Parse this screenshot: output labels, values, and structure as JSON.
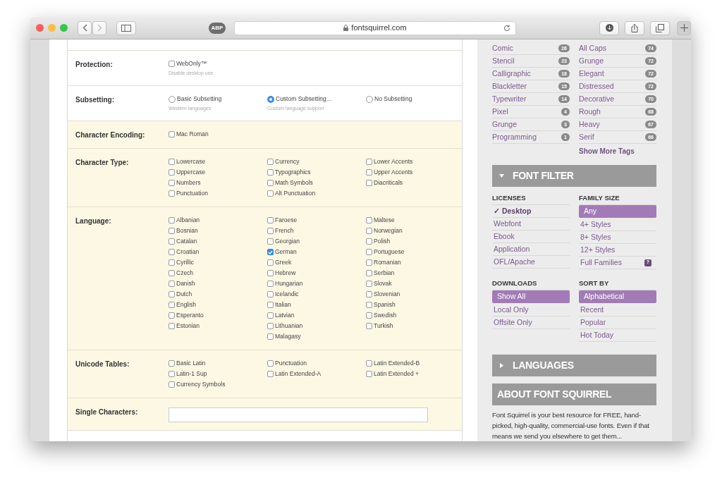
{
  "browser": {
    "address": "fontsquirrel.com",
    "adblock": "ABP"
  },
  "form": {
    "sections": [
      {
        "label": "Protection:",
        "highlighted": false,
        "kind": "checkbox",
        "columns": [
          [
            {
              "label": "WebOnly™",
              "hint": "Disable desktop use",
              "checked": false
            }
          ]
        ]
      },
      {
        "label": "Subsetting:",
        "highlighted": false,
        "kind": "radio",
        "columns": [
          [
            {
              "label": "Basic Subsetting",
              "hint": "Western languages",
              "selected": false
            }
          ],
          [
            {
              "label": "Custom Subsetting…",
              "hint": "Custom language support",
              "selected": true
            }
          ],
          [
            {
              "label": "No Subsetting",
              "selected": false
            }
          ]
        ]
      },
      {
        "label": "Character Encoding:",
        "highlighted": true,
        "kind": "checkbox",
        "columns": [
          [
            {
              "label": "Mac Roman",
              "checked": false
            }
          ]
        ]
      },
      {
        "label": "Character Type:",
        "highlighted": true,
        "kind": "checkbox",
        "columns": [
          [
            {
              "label": "Lowercase",
              "checked": false
            },
            {
              "label": "Uppercase",
              "checked": false
            },
            {
              "label": "Numbers",
              "checked": false
            },
            {
              "label": "Punctuation",
              "checked": false
            }
          ],
          [
            {
              "label": "Currency",
              "checked": false
            },
            {
              "label": "Typographics",
              "checked": false
            },
            {
              "label": "Math Symbols",
              "checked": false
            },
            {
              "label": "Alt Punctuation",
              "checked": false
            }
          ],
          [
            {
              "label": "Lower Accents",
              "checked": false
            },
            {
              "label": "Upper Accents",
              "checked": false
            },
            {
              "label": "Diacriticals",
              "checked": false
            }
          ]
        ]
      },
      {
        "label": "Language:",
        "highlighted": true,
        "kind": "checkbox",
        "columns": [
          [
            {
              "label": "Albanian",
              "checked": false
            },
            {
              "label": "Bosnian",
              "checked": false
            },
            {
              "label": "Catalan",
              "checked": false
            },
            {
              "label": "Croatian",
              "checked": false
            },
            {
              "label": "Cyrillic",
              "checked": false
            },
            {
              "label": "Czech",
              "checked": false
            },
            {
              "label": "Danish",
              "checked": false
            },
            {
              "label": "Dutch",
              "checked": false
            },
            {
              "label": "English",
              "checked": false
            },
            {
              "label": "Esperanto",
              "checked": false
            },
            {
              "label": "Estonian",
              "checked": false
            }
          ],
          [
            {
              "label": "Faroese",
              "checked": false
            },
            {
              "label": "French",
              "checked": false
            },
            {
              "label": "Georgian",
              "checked": false
            },
            {
              "label": "German",
              "checked": true
            },
            {
              "label": "Greek",
              "checked": false
            },
            {
              "label": "Hebrew",
              "checked": false
            },
            {
              "label": "Hungarian",
              "checked": false
            },
            {
              "label": "Icelandic",
              "checked": false
            },
            {
              "label": "Italian",
              "checked": false
            },
            {
              "label": "Latvian",
              "checked": false
            },
            {
              "label": "Lithuanian",
              "checked": false
            },
            {
              "label": "Malagasy",
              "checked": false
            }
          ],
          [
            {
              "label": "Maltese",
              "checked": false
            },
            {
              "label": "Norwegian",
              "checked": false
            },
            {
              "label": "Polish",
              "checked": false
            },
            {
              "label": "Portuguese",
              "checked": false
            },
            {
              "label": "Romanian",
              "checked": false
            },
            {
              "label": "Serbian",
              "checked": false
            },
            {
              "label": "Slovak",
              "checked": false
            },
            {
              "label": "Slovenian",
              "checked": false
            },
            {
              "label": "Spanish",
              "checked": false
            },
            {
              "label": "Swedish",
              "checked": false
            },
            {
              "label": "Turkish",
              "checked": false
            }
          ]
        ]
      },
      {
        "label": "Unicode Tables:",
        "highlighted": true,
        "kind": "checkbox",
        "columns": [
          [
            {
              "label": "Basic Latin",
              "checked": false
            },
            {
              "label": "Latin-1 Sup",
              "checked": false
            },
            {
              "label": "Currency Symbols",
              "checked": false
            }
          ],
          [
            {
              "label": "Punctuation",
              "checked": false
            },
            {
              "label": "Latin Extended-A",
              "checked": false
            }
          ],
          [
            {
              "label": "Latin Extended-B",
              "checked": false
            },
            {
              "label": "Latin Extended +",
              "checked": false
            }
          ]
        ]
      },
      {
        "label": "Single Characters:",
        "highlighted": true,
        "kind": "field"
      }
    ]
  },
  "sidebar": {
    "tags": {
      "columns": [
        [
          {
            "label": "Comic",
            "count": "26"
          },
          {
            "label": "Stencil",
            "count": "23"
          },
          {
            "label": "Calligraphic",
            "count": "18"
          },
          {
            "label": "Blackletter",
            "count": "15"
          },
          {
            "label": "Typewriter",
            "count": "14"
          },
          {
            "label": "Pixel",
            "count": "4"
          },
          {
            "label": "Grunge",
            "count": "3"
          },
          {
            "label": "Programming",
            "count": "1"
          }
        ],
        [
          {
            "label": "All Caps",
            "count": "74"
          },
          {
            "label": "Grunge",
            "count": "72"
          },
          {
            "label": "Elegant",
            "count": "72"
          },
          {
            "label": "Distressed",
            "count": "72"
          },
          {
            "label": "Decorative",
            "count": "70"
          },
          {
            "label": "Rough",
            "count": "68"
          },
          {
            "label": "Heavy",
            "count": "67"
          },
          {
            "label": "Serif",
            "count": "66"
          }
        ]
      ],
      "more": "Show More Tags"
    },
    "font_filter": {
      "title": "FONT FILTER",
      "expanded": true,
      "groups": [
        {
          "heading": "LICENSES",
          "kind": "check",
          "check": "✓",
          "items": [
            {
              "label": "Desktop",
              "selected": true
            },
            {
              "label": "Webfont",
              "selected": false
            },
            {
              "label": "Ebook",
              "selected": false
            },
            {
              "label": "Application",
              "selected": false
            },
            {
              "label": "OFL/Apache",
              "selected": false
            }
          ]
        },
        {
          "heading": "FAMILY SIZE",
          "kind": "highlight",
          "items": [
            {
              "label": "Any",
              "selected": true
            },
            {
              "label": "4+ Styles",
              "selected": false
            },
            {
              "label": "8+ Styles",
              "selected": false
            },
            {
              "label": "12+ Styles",
              "selected": false
            },
            {
              "label": "Full Families",
              "selected": false,
              "help": "?"
            }
          ]
        },
        {
          "heading": "DOWNLOADS",
          "kind": "highlight",
          "items": [
            {
              "label": "Show All",
              "selected": true
            },
            {
              "label": "Local Only",
              "selected": false
            },
            {
              "label": "Offsite Only",
              "selected": false
            }
          ]
        },
        {
          "heading": "SORT BY",
          "kind": "highlight",
          "items": [
            {
              "label": "Alphabetical",
              "selected": true
            },
            {
              "label": "Recent",
              "selected": false
            },
            {
              "label": "Popular",
              "selected": false
            },
            {
              "label": "Hot Today",
              "selected": false
            }
          ]
        }
      ]
    },
    "languages": {
      "title": "LANGUAGES",
      "expanded": false
    },
    "about": {
      "title": "ABOUT FONT SQUIRREL",
      "text": "Font Squirrel is your best resource for FREE, hand-picked, high-quality, commercial-use fonts. Even if that means we send you elsewhere to get them..."
    }
  }
}
